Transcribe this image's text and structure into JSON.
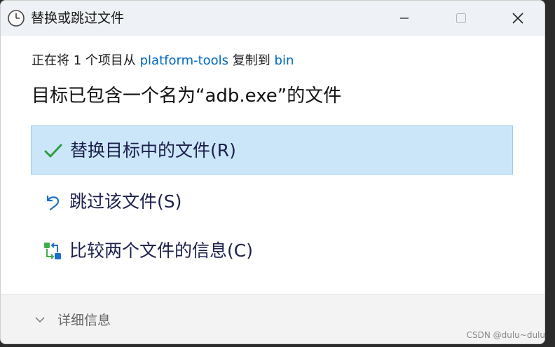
{
  "window": {
    "title": "替换或跳过文件"
  },
  "dialog": {
    "subtitle_prefix": "正在将 1 个项目从 ",
    "source_folder": "platform-tools",
    "subtitle_middle": " 复制到 ",
    "dest_folder": "bin",
    "heading": "目标已包含一个名为“adb.exe”的文件",
    "options": [
      {
        "label": "替换目标中的文件(R)",
        "icon": "checkmark-icon",
        "selected": true
      },
      {
        "label": "跳过该文件(S)",
        "icon": "skip-arrow-icon",
        "selected": false
      },
      {
        "label": "比较两个文件的信息(C)",
        "icon": "compare-icon",
        "selected": false
      }
    ],
    "details_label": "详细信息"
  },
  "watermark": "CSDN @dulu~dulu",
  "colors": {
    "accent": "#0067c0",
    "selected_bg": "#cce6f9",
    "check_green": "#2e9e3e"
  }
}
